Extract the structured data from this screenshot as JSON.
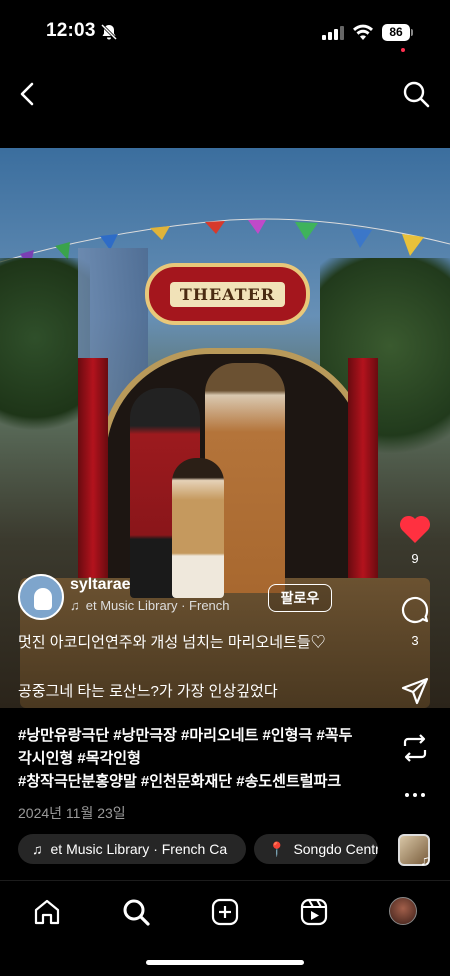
{
  "status": {
    "time": "12:03",
    "battery": "86"
  },
  "post": {
    "username": "syltarae",
    "music_line": "et Music Library · French",
    "follow_label": "팔로우",
    "caption_line1": "멋진 아코디언연주와 개성 넘치는 마리오네트들♡",
    "caption_line2": "공중그네 타는 로산느?가 가장 인상깊었다",
    "likes": "9",
    "comments": "3",
    "sign_text": "THEATER",
    "hashtags": [
      "#낭만유랑극단 #낭만극장 #마리오네트 #인형극 #꼭두",
      "각시인형 #목각인형",
      "#창작극단분홍양말 #인천문화재단 #송도센트럴파크"
    ],
    "date": "2024년 11월 23일",
    "chips": {
      "music": "et Music Library · French Ca",
      "location": "Songdo Centr"
    }
  },
  "icons": {
    "back": "back-chevron-icon",
    "search": "search-icon",
    "like": "heart-filled-icon",
    "comment": "comment-icon",
    "share": "send-icon",
    "repost": "repost-icon",
    "more": "more-icon",
    "home": "home-icon",
    "create": "create-plus-icon",
    "reels": "reels-icon"
  },
  "colors": {
    "like": "#ff3040",
    "background": "#000000"
  }
}
